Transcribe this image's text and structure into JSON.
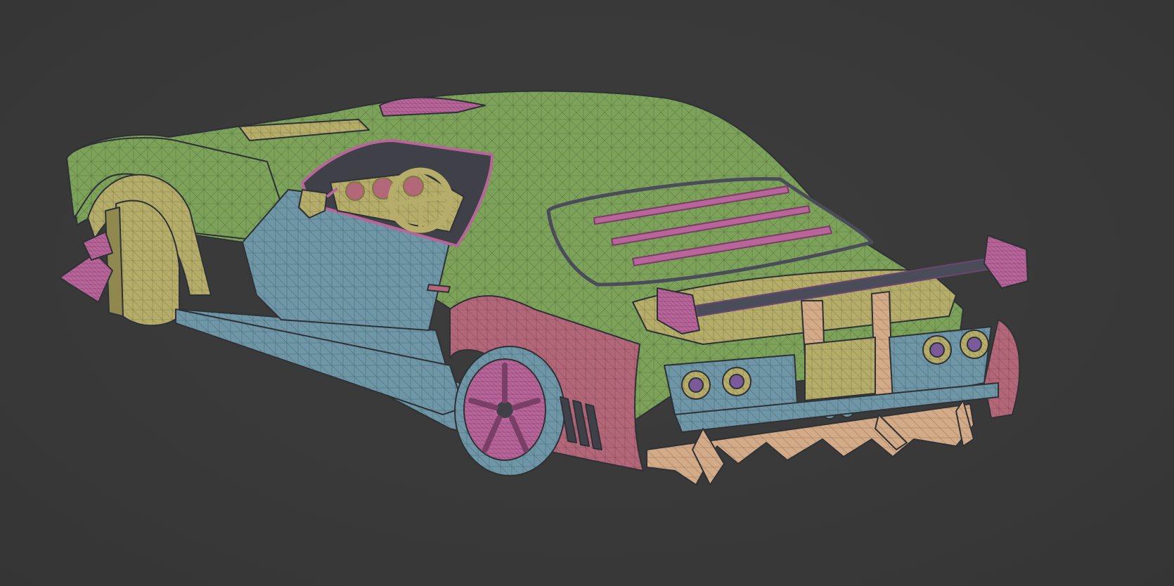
{
  "viewport": {
    "background": "#3a3a3a"
  },
  "model": {
    "subject": "car-wireframe-mesh",
    "palette": {
      "green": "#7da25a",
      "blue": "#6e96a6",
      "yellow": "#b5ad69",
      "pink": "#b3687a",
      "magenta": "#b8659a",
      "peach": "#d3ab88",
      "dark": "#3f4048"
    }
  }
}
